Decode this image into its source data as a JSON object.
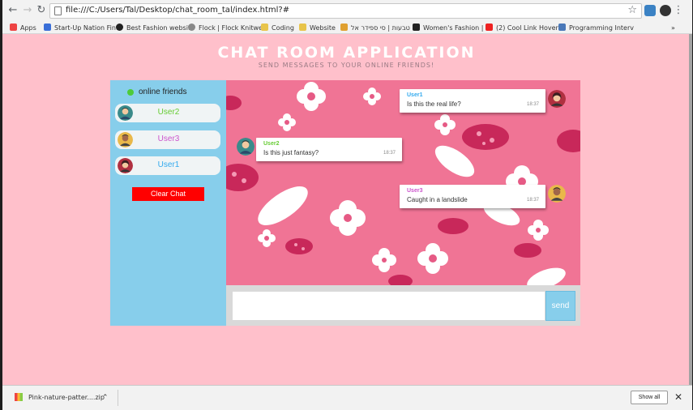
{
  "browser": {
    "url": "file:///C:/Users/Tal/Desktop/chat_room_tal/index.html?#",
    "bookmarks": [
      {
        "label": "Apps",
        "icon": "apps-grid-icon",
        "color": "#e44"
      },
      {
        "label": "Start-Up Nation Find",
        "icon": "flag-icon",
        "color": "#3a6fd8"
      },
      {
        "label": "Best Fashion website",
        "icon": "site-icon",
        "color": "#222"
      },
      {
        "label": "Flock | Flock Knitwe",
        "icon": "site-icon",
        "color": "#888"
      },
      {
        "label": "Coding",
        "icon": "folder-icon",
        "color": "#e8c44a"
      },
      {
        "label": "Website",
        "icon": "folder-icon",
        "color": "#e8c44a"
      },
      {
        "label": "טבעות | סי ספידר אל",
        "icon": "site-icon",
        "color": "#e0a030"
      },
      {
        "label": "Women's Fashion |",
        "icon": "site-icon",
        "color": "#222"
      },
      {
        "label": "(2) Cool Link Hover",
        "icon": "youtube-icon",
        "color": "#e22"
      },
      {
        "label": "Programming Interv",
        "icon": "site-icon",
        "color": "#4a78b8"
      }
    ],
    "more": "»"
  },
  "app": {
    "title": "CHAT ROOM APPLICATION",
    "subtitle": "SEND MESSAGES TO YOUR ONLINE FRIENDS!",
    "online_label": "online friends",
    "friends": [
      {
        "name": "User2",
        "color": "#66cc33",
        "avatar_color": "#3a8a8a"
      },
      {
        "name": "User3",
        "color": "#cc55cc",
        "avatar_color": "#e9b84a"
      },
      {
        "name": "User1",
        "color": "#33aaee",
        "avatar_color": "#b03040"
      }
    ],
    "clear_label": "Clear Chat",
    "messages": [
      {
        "user": "User1",
        "text": "Is this the real life?",
        "time": "18:37",
        "color": "#33aaee"
      },
      {
        "user": "User2",
        "text": "Is this just fantasy?",
        "time": "18:37",
        "color": "#66cc33"
      },
      {
        "user": "User3",
        "text": "Caught in a landslide",
        "time": "18:37",
        "color": "#cc55cc"
      }
    ],
    "input_placeholder": "",
    "send_label": "send"
  },
  "downloads": {
    "file": "Pink-nature-patter....zip",
    "show_all": "Show all"
  }
}
